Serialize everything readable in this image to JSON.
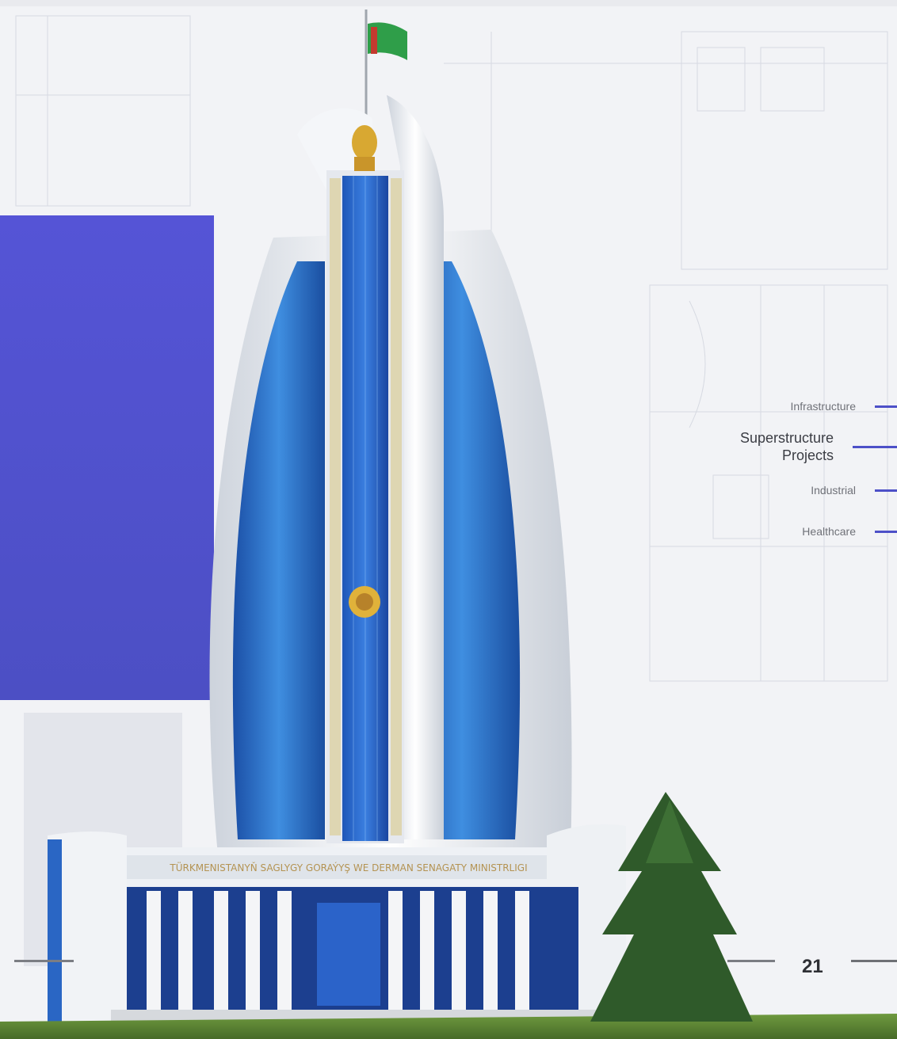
{
  "page": {
    "number": "21",
    "colors": {
      "accent": "#5554d6",
      "nav_line": "#4d50c8",
      "background": "#f2f3f6"
    }
  },
  "navigation": {
    "items": [
      {
        "label": "Infrastructure",
        "active": false
      },
      {
        "label": "Superstructure Projects",
        "label_line1": "Superstructure",
        "label_line2": "Projects",
        "active": true
      },
      {
        "label": "Industrial",
        "active": false
      },
      {
        "label": "Healthcare",
        "active": false
      }
    ]
  },
  "photo": {
    "facade_text": "TÜRKMENISTANYŇ SAGLYGY GORAÝYŞ WE DERMAN SENAGATY MINISTRLIGI"
  }
}
